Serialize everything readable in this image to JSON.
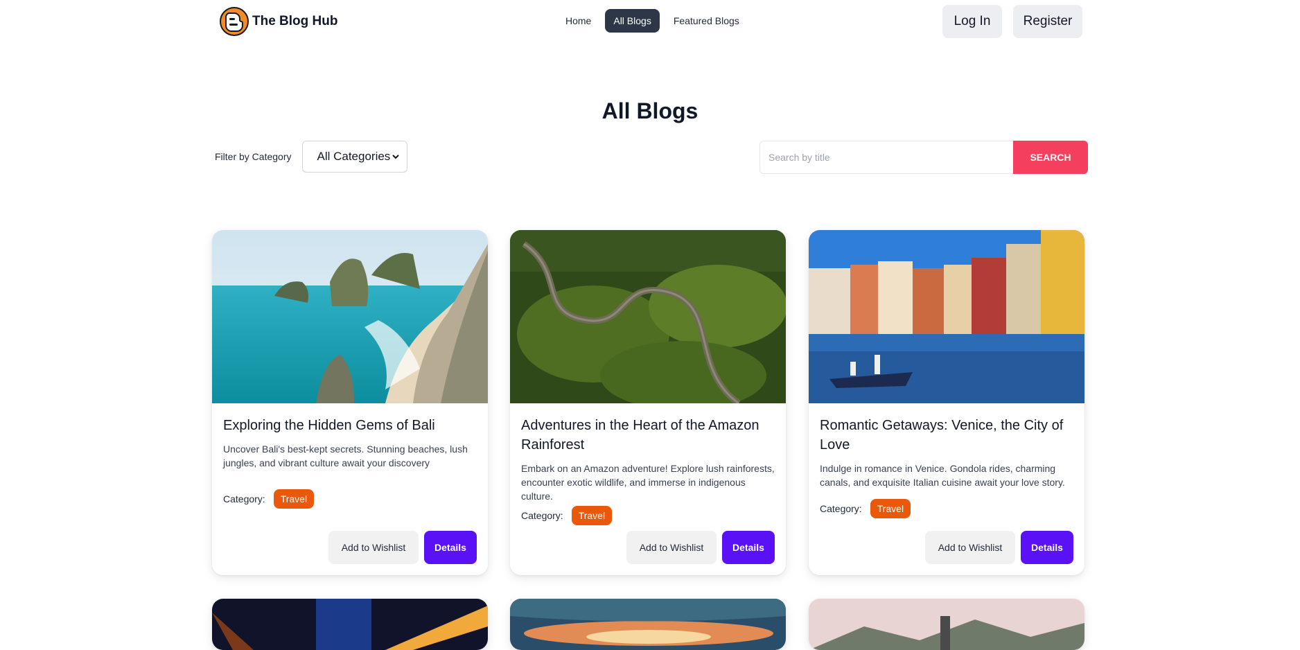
{
  "brand": {
    "name": "The Blog Hub"
  },
  "nav": {
    "links": [
      {
        "label": "Home",
        "active": false
      },
      {
        "label": "All Blogs",
        "active": true
      },
      {
        "label": "Featured Blogs",
        "active": false
      }
    ]
  },
  "auth": {
    "login_label": "Log In",
    "register_label": "Register"
  },
  "page": {
    "title": "All Blogs"
  },
  "filter": {
    "label": "Filter by Category",
    "selected": "All Categories"
  },
  "search": {
    "placeholder": "Search by title",
    "button_label": "SEARCH"
  },
  "cards": [
    {
      "title": "Exploring the Hidden Gems of Bali",
      "description": "Uncover Bali's best-kept secrets. Stunning beaches, lush jungles, and vibrant culture await your discovery",
      "category_label": "Category:",
      "category": "Travel",
      "wishlist_label": "Add to Wishlist",
      "details_label": "Details"
    },
    {
      "title": "Adventures in the Heart of the Amazon Rainforest",
      "description": "Embark on an Amazon adventure! Explore lush rainforests, encounter exotic wildlife, and immerse in indigenous culture.",
      "category_label": "Category:",
      "category": "Travel",
      "wishlist_label": "Add to Wishlist",
      "details_label": "Details"
    },
    {
      "title": "Romantic Getaways: Venice, the City of Love",
      "description": "Indulge in romance in Venice. Gondola rides, charming canals, and exquisite Italian cuisine await your love story.",
      "category_label": "Category:",
      "category": "Travel",
      "wishlist_label": "Add to Wishlist",
      "details_label": "Details"
    }
  ],
  "colors": {
    "nav_active_bg": "#2d3748",
    "search_button": "#f43f5e",
    "badge": "#ea580c",
    "details_button": "#5b11f5"
  },
  "icons": {
    "logo": "blog-logo-icon",
    "select": "chevron-down-icon"
  }
}
